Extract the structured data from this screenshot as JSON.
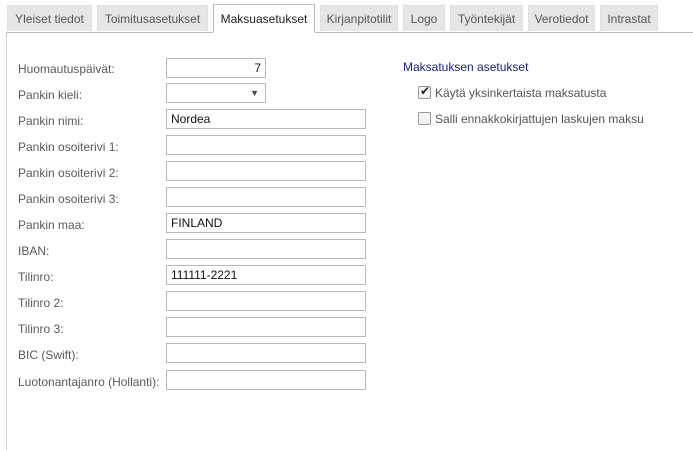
{
  "tabs": [
    {
      "label": "Yleiset tiedot"
    },
    {
      "label": "Toimitusasetukset"
    },
    {
      "label": "Maksuasetukset"
    },
    {
      "label": "Kirjanpitotilit"
    },
    {
      "label": "Logo"
    },
    {
      "label": "Työntekijät"
    },
    {
      "label": "Verotiedot"
    },
    {
      "label": "Intrastat"
    }
  ],
  "active_tab": "Maksuasetukset",
  "form": {
    "reminder_days": {
      "label": "Huomautuspäivät:",
      "value": "7"
    },
    "bank_language": {
      "label": "Pankin kieli:",
      "value": ""
    },
    "bank_name": {
      "label": "Pankin nimi:",
      "value": "Nordea"
    },
    "bank_address1": {
      "label": "Pankin osoiterivi 1:",
      "value": ""
    },
    "bank_address2": {
      "label": "Pankin osoiterivi 2:",
      "value": ""
    },
    "bank_address3": {
      "label": "Pankin osoiterivi 3:",
      "value": ""
    },
    "bank_country": {
      "label": "Pankin maa:",
      "value": "FINLAND"
    },
    "iban": {
      "label": "IBAN:",
      "value": ""
    },
    "account": {
      "label": "Tilinro:",
      "value": "111111-2221"
    },
    "account2": {
      "label": "Tilinro 2:",
      "value": ""
    },
    "account3": {
      "label": "Tilinro 3:",
      "value": ""
    },
    "bic": {
      "label": "BIC (Swift):",
      "value": ""
    },
    "creditor_id": {
      "label": "Luotonantajanro (Hollanti):",
      "value": ""
    }
  },
  "payment_settings": {
    "title": "Maksatuksen asetukset",
    "simple_payment": {
      "label": "Käytä yksinkertaista maksatusta",
      "checked": true
    },
    "allow_prebooked": {
      "label": "Salli ennakkokirjattujen laskujen maksu",
      "checked": false
    }
  }
}
